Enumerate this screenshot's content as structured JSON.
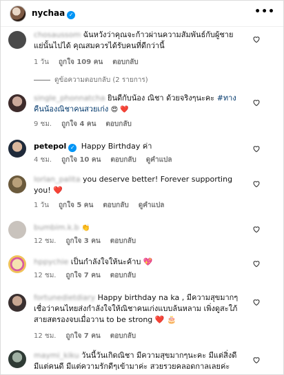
{
  "header": {
    "username": "nychaa",
    "more_label": "•••"
  },
  "comments": [
    {
      "user": "chosaussom",
      "text": "ฉันหวังว่าคุณจะก้าวผ่านความสัมพันธ์กับผู้ชายแย่นั้นไปได้ คุณสมควรได้รับคนที่ดีกว่านี้",
      "time": "1 วัน",
      "likes": "ถูกใจ 109 คน",
      "reply": "ตอบกลับ"
    },
    {
      "user": "single_phonnatcha",
      "text": "ยินดีกับน้อง ณิชา ด้วยจริงๆนะคะ",
      "hashtag": "#ทางคืนน้องณิชาคนสวยเก่ง",
      "emoji": "😍 ❤️",
      "time": "9 ชม.",
      "likes": "ถูกใจ 4 คน",
      "reply": "ตอบกลับ"
    },
    {
      "user": "petepol",
      "text": "Happy Birthday ค่า",
      "time": "4 ชม.",
      "likes": "ถูกใจ 10 คน",
      "reply": "ตอบกลับ",
      "translate": "ดูคำแปล"
    },
    {
      "user": "lorlan_palita",
      "text": "you deserve better! Forever supporting you! ❤️",
      "time": "1 วัน",
      "likes": "ถูกใจ 5 คน",
      "reply": "ตอบกลับ",
      "translate": "ดูคำแปล"
    },
    {
      "user": "bumbim.k.b",
      "text": "👏",
      "time": "12 ชม.",
      "likes": "ถูกใจ 3 คน",
      "reply": "ตอบกลับ"
    },
    {
      "user": "hppychie",
      "text": "เป็นกำลังใจให้นะค้าบ 💖",
      "time": "12 ชม.",
      "likes": "ถูกใจ 7 คน",
      "reply": "ตอบกลับ"
    },
    {
      "user": "fortunedietdiary",
      "text": "Happy birthday na ka , มีความสุขมากๆ เชื่อว่าคนไทยส่งกำลังใจให้ณิชาคนเก่งแบบล้นหลาม เพิ่งดูสะใภ้สายสตรองจบเมื่อวาน to be strong ❤️ 🎂",
      "time": "12 ชม.",
      "likes": "ถูกใจ 7 คน",
      "reply": "ตอบกลับ"
    },
    {
      "user": "maymi_kiku",
      "text": "วันนี้วันเกิดณิชา มีความสุขมากๆนะคะ มีแต่สิ่งดี มีแต่คนดี มีแต่ความรักดีๆเข้ามาค่ะ สวยรวยคลอดกาลเลยค่ะ"
    }
  ],
  "view_replies": "ดูข้อความตอบกลับ (2 รายการ)",
  "colors": {
    "verified": "#0095f6",
    "meta": "#737373",
    "heart_fill": "#ff3040"
  }
}
